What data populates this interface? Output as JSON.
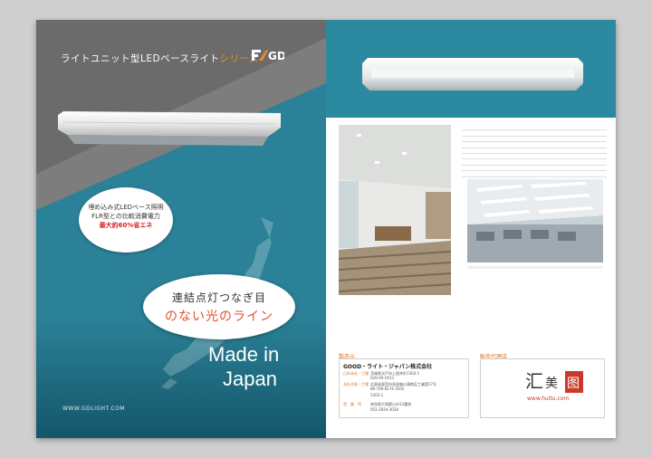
{
  "cover": {
    "title_main": "ライトユニット型LEDベースライト",
    "title_series": "シリーズ",
    "logo_text": "GD",
    "bubble_small": {
      "line1": "埋め込み式LEDベース照明",
      "line2": "FLR型との比較消費電力",
      "line3": "最大約60%省エネ"
    },
    "bubble_large": {
      "line1": "連結点灯つなぎ目",
      "line2": "のない光のライン"
    },
    "made_line1": "Made in",
    "made_line2": "Japan",
    "website": "WWW.GDLIGHT.COM"
  },
  "back": {
    "maker": {
      "section_label": "製造元",
      "company": "GOOD・ライト・ジャパン株式会社",
      "rows": [
        {
          "label": "日本本社・工場",
          "value": "茨城県水戸市上国井町1303-1"
        },
        {
          "label": "",
          "value": "029-49-1913"
        },
        {
          "label": "本社本部・工場",
          "value": "広東省東莞市長安鎮沙頭南区工業園17号"
        },
        {
          "label": "",
          "value": "86-769-8174-3502"
        },
        {
          "label": "",
          "value": "1303-1"
        },
        {
          "label": "営　業　所",
          "value": "奈良県大和郡山市13番地"
        },
        {
          "label": "",
          "value": "052-2834-3038"
        }
      ]
    },
    "dealer": {
      "section_label": "販売代理店"
    },
    "stamp": {
      "caption": "www.huitu.com"
    }
  },
  "colors": {
    "teal": "#2b8197",
    "grey": "#7d7d7d",
    "orange": "#f08a24",
    "red": "#d8272a"
  }
}
